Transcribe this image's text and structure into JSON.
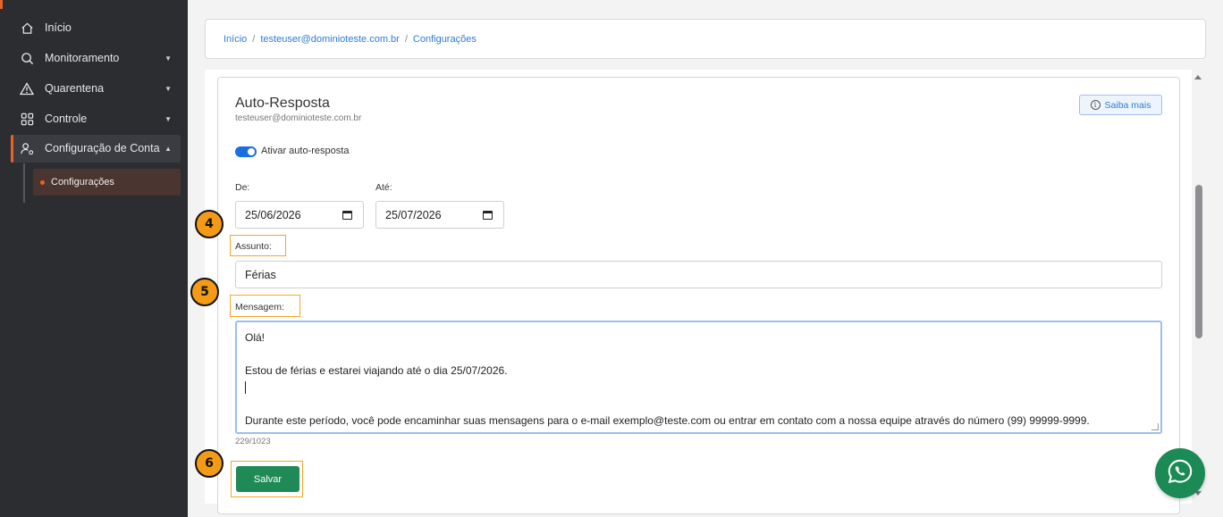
{
  "sidebar": {
    "items": [
      {
        "label": "Início",
        "icon": "home-icon"
      },
      {
        "label": "Monitoramento",
        "icon": "search-icon",
        "caret": "▼"
      },
      {
        "label": "Quarentena",
        "icon": "warning-icon",
        "caret": "▼"
      },
      {
        "label": "Controle",
        "icon": "grid-icon",
        "caret": "▼"
      },
      {
        "label": "Configuração de Conta",
        "icon": "user-settings-icon",
        "caret": "▲"
      }
    ],
    "subitem": "Configurações",
    "accent_color": "#e8632b"
  },
  "breadcrumb": {
    "items": [
      "Início",
      "testeuser@dominioteste.com.br",
      "Configurações"
    ],
    "separator": "/"
  },
  "card": {
    "title": "Auto-Resposta",
    "subtitle": "testeuser@dominioteste.com.br",
    "help_button": "Saiba mais",
    "toggle_label": "Ativar auto-resposta",
    "toggle_on": true,
    "from_label": "De:",
    "from_value": "25/06/2026",
    "to_label": "Até:",
    "to_value": "25/07/2026",
    "subject_label": "Assunto:",
    "subject_value": "Férias",
    "message_label": "Mensagem:",
    "message_lines": [
      "Olá!",
      "",
      "Estou de férias e estarei viajando até o dia 25/07/2026.",
      "",
      "",
      "Durante este período, você pode encaminhar suas mensagens para o e-mail exemplo@teste.com ou entrar em contato com a nossa equipe através do número (99) 99999-9999."
    ],
    "counter": "229/1023",
    "save_button": "Salvar",
    "save_color": "#1f8a56"
  },
  "markers": [
    "4",
    "5",
    "6"
  ],
  "marker_color": "#f39a16"
}
